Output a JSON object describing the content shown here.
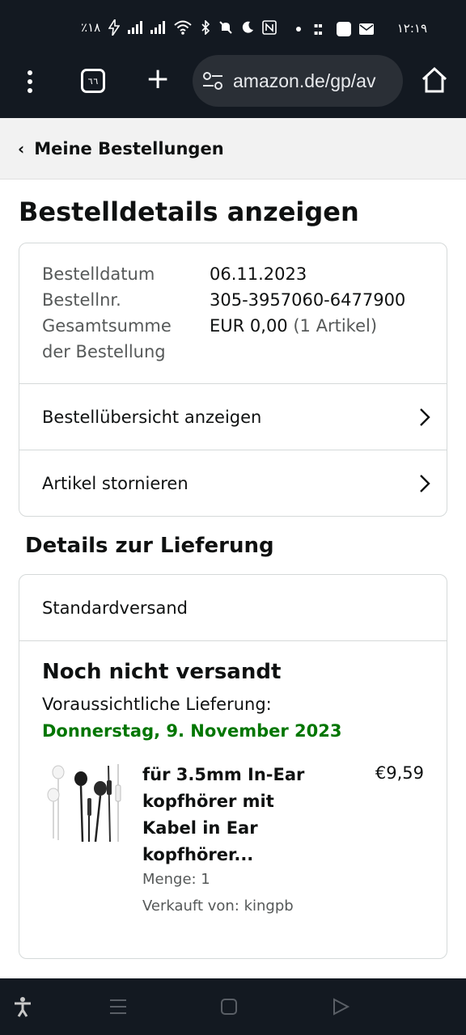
{
  "status_bar": {
    "battery": "٪١٨",
    "time": "١٢:١٩"
  },
  "browser": {
    "tab_count": "٦٦",
    "url": "amazon.de/gp/av"
  },
  "nav": {
    "back_label": "Meine Bestellungen"
  },
  "page": {
    "title": "Bestelldetails anzeigen"
  },
  "order": {
    "date_label": "Bestelldatum",
    "date_value": "06.11.2023",
    "number_label": "Bestellnr.",
    "number_value": "305-3957060-6477900",
    "total_label_line1": "Gesamtsumme",
    "total_label_line2": "der Bestellung",
    "total_value": "EUR 0,00",
    "total_items": "(1 Artikel)"
  },
  "actions": {
    "view_summary": "Bestellübersicht anzeigen",
    "cancel_items": "Artikel stornieren"
  },
  "delivery": {
    "section_title": "Details zur Lieferung",
    "method": "Standardversand",
    "status": "Noch nicht versandt",
    "eta_label": "Voraussichtliche Lieferung:",
    "eta_date": "Donnerstag, 9. November 2023"
  },
  "item": {
    "title": "für 3.5mm In-Ear kopfhörer mit Kabel in Ear kopfhörer...",
    "price": "€9,59",
    "quantity": "Menge: 1",
    "seller": "Verkauft von: kingpb"
  },
  "colors": {
    "chrome": "#131921",
    "delivery_green": "#007600",
    "border": "#d5d9d9",
    "muted_text": "#565959"
  }
}
